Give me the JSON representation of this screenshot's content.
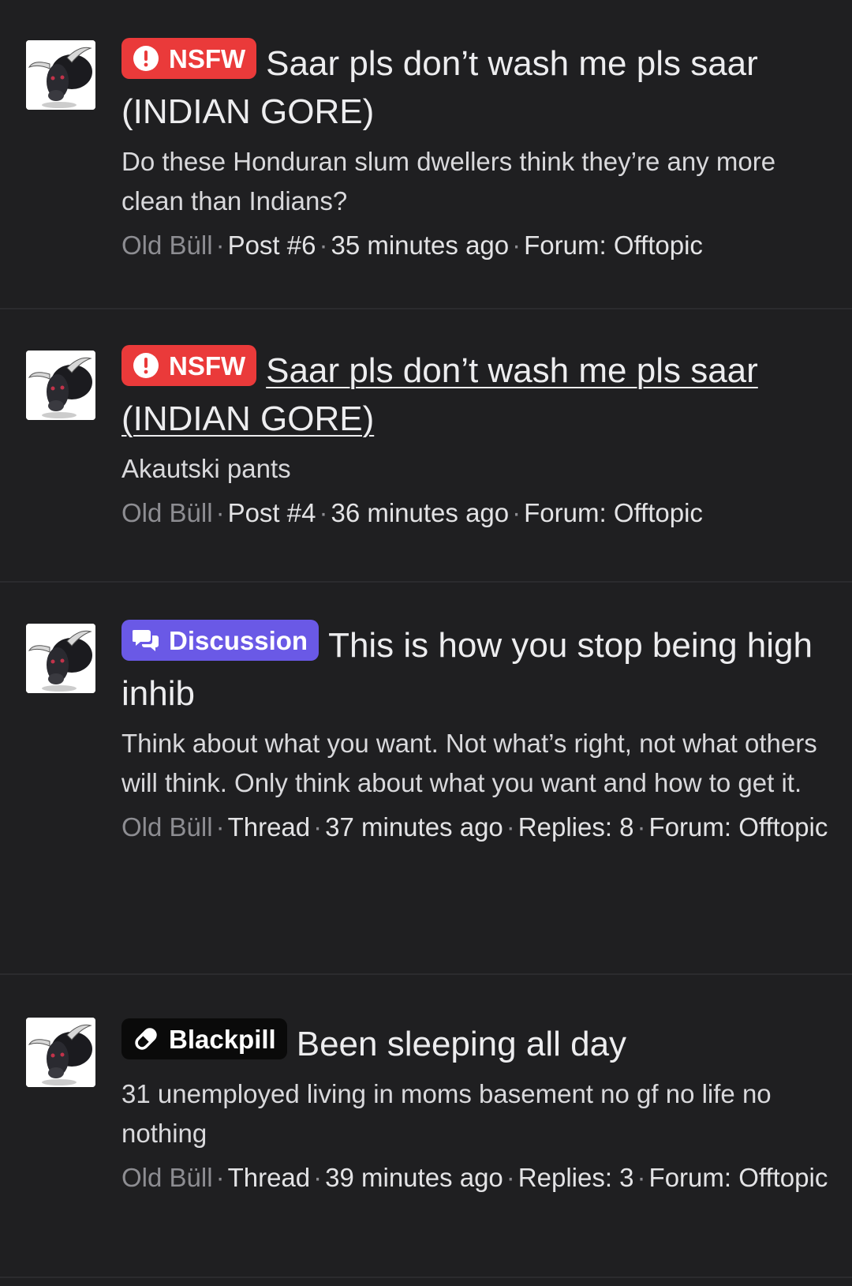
{
  "colors": {
    "background": "#1f1f21",
    "nsfw_badge": "#ea3a3a",
    "discussion_badge": "#6a59e6",
    "blackpill_badge": "#0a0a0a",
    "author_text": "#8d8d92"
  },
  "items": [
    {
      "badge": {
        "label": "NSFW",
        "icon": "exclamation-circle-icon"
      },
      "title": "Saar pls don’t wash me pls saar (INDIAN GORE)",
      "snippet": "Do these Honduran slum dwellers think they’re any more clean than Indians?",
      "meta": {
        "author": "Old Büll",
        "type": "Post #6",
        "time": "35 minutes ago",
        "forum": "Forum: Offtopic"
      }
    },
    {
      "badge": {
        "label": "NSFW",
        "icon": "exclamation-circle-icon"
      },
      "title": "Saar pls don’t wash me pls saar (INDIAN GORE)",
      "snippet": "Akautski pants",
      "meta": {
        "author": "Old Büll",
        "type": "Post #4",
        "time": "36 minutes ago",
        "forum": "Forum: Offtopic"
      }
    },
    {
      "badge": {
        "label": "Discussion",
        "icon": "chat-bubbles-icon"
      },
      "title": "This is how you stop being high inhib",
      "snippet": "Think about what you want. Not what’s right, not what others will think. Only think about what you want and how to get it.",
      "meta": {
        "author": "Old Büll",
        "type": "Thread",
        "time": "37 minutes ago",
        "replies": "Replies: 8",
        "forum": "Forum: Offtopic"
      }
    },
    {
      "badge": {
        "label": "Blackpill",
        "icon": "pill-icon"
      },
      "title": "Been sleeping all day",
      "snippet": "31 unemployed living in moms basement no gf no life no nothing",
      "meta": {
        "author": "Old Büll",
        "type": "Thread",
        "time": "39 minutes ago",
        "replies": "Replies: 3",
        "forum": "Forum: Offtopic"
      }
    }
  ]
}
